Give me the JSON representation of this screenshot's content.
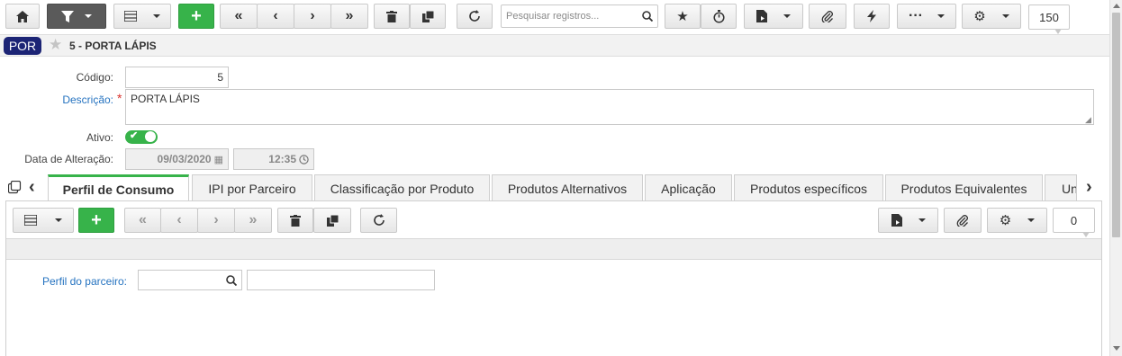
{
  "toolbar": {
    "search_placeholder": "Pesquisar registros...",
    "page_size": "150"
  },
  "record": {
    "badge": "POR",
    "title": "5 - PORTA LÁPIS"
  },
  "form": {
    "codigo_label": "Código:",
    "codigo_value": "5",
    "descricao_label": "Descrição:",
    "descricao_required": "*",
    "descricao_value": "PORTA LÁPIS",
    "ativo_label": "Ativo:",
    "data_label": "Data de Alteração:",
    "data_value": "09/03/2020",
    "hora_value": "12:35"
  },
  "tabs": [
    {
      "label": "Perfil de Consumo"
    },
    {
      "label": "IPI por Parceiro"
    },
    {
      "label": "Classificação por Produto"
    },
    {
      "label": "Produtos Alternativos"
    },
    {
      "label": "Aplicação"
    },
    {
      "label": "Produtos específicos"
    },
    {
      "label": "Produtos Equivalentes"
    },
    {
      "label": "Un"
    }
  ],
  "subgrid": {
    "record_count": "0",
    "perfil_label": "Perfil do parceiro:"
  },
  "colors": {
    "accent_green": "#37b34a",
    "badge_blue": "#1c2475",
    "label_blue": "#2573c0",
    "required_red": "#d9302b"
  }
}
